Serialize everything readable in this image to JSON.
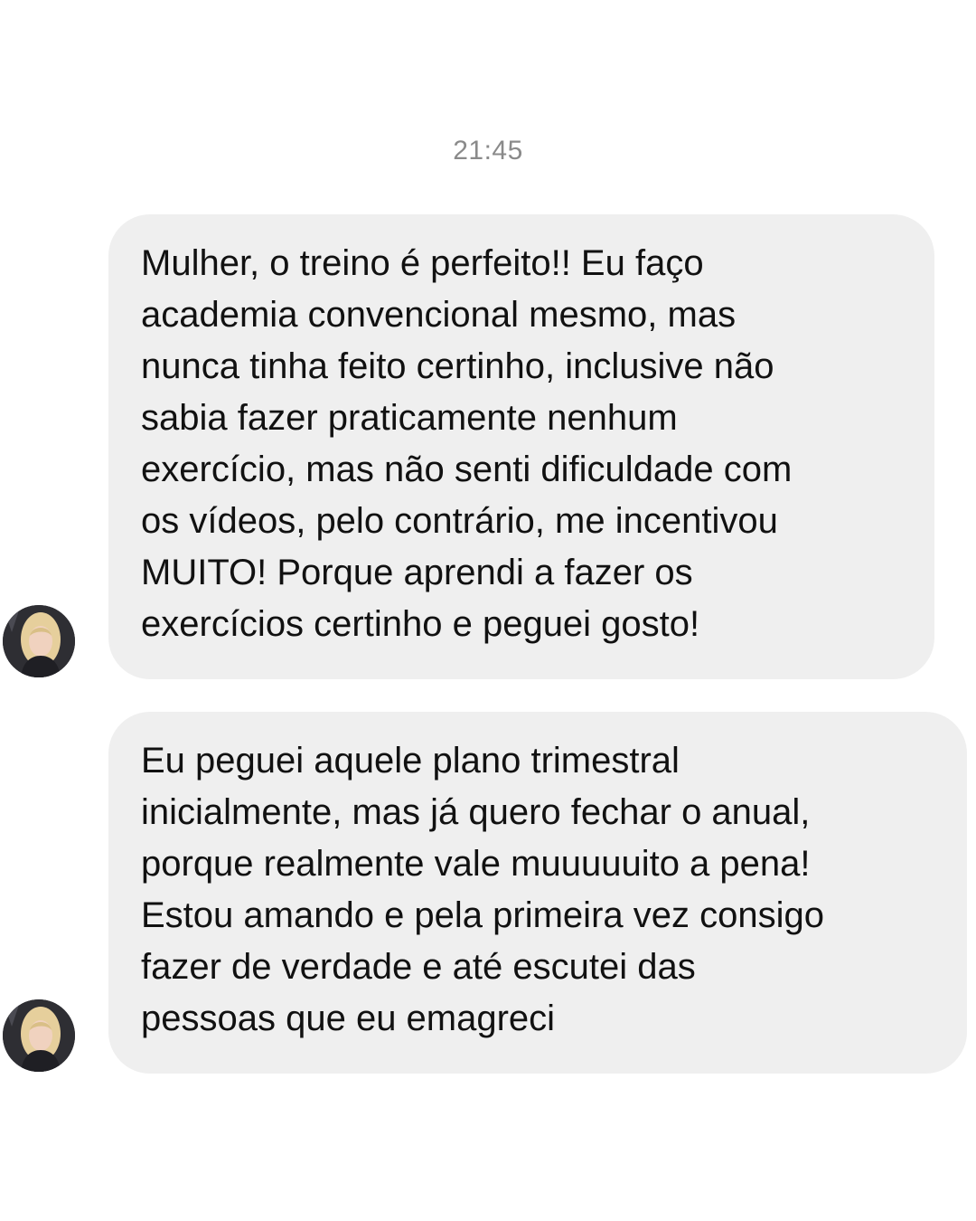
{
  "conversation": {
    "timestamp": "21:45",
    "messages": [
      {
        "sender_avatar": "contact-avatar",
        "text": "Mulher, o treino é perfeito!! Eu faço\nacademia convencional mesmo, mas\nnunca tinha feito certinho, inclusive não\nsabia fazer praticamente nenhum\nexercício, mas não senti dificuldade com\nos vídeos, pelo contrário, me incentivou\nMUITO! Porque aprendi a fazer os\nexercícios certinho e peguei gosto!"
      },
      {
        "sender_avatar": "contact-avatar",
        "text": "Eu peguei aquele plano trimestral\ninicialmente, mas já quero fechar o anual,\nporque realmente vale muuuuuito a pena!\nEstou amando e pela primeira vez consigo\nfazer de verdade e até escutei das\npessoas que eu emagreci"
      }
    ]
  },
  "colors": {
    "background": "#ffffff",
    "bubble_background": "#efefef",
    "message_text": "#111111",
    "timestamp_text": "#8a8a8a"
  }
}
